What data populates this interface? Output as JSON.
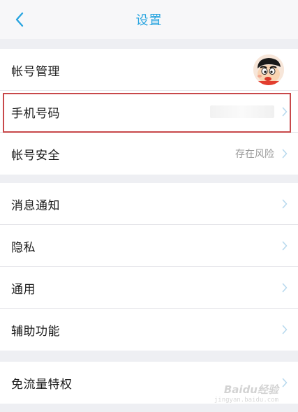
{
  "header": {
    "title": "设置"
  },
  "groups": {
    "account": {
      "account_management": {
        "label": "帐号管理"
      },
      "phone_number": {
        "label": "手机号码"
      },
      "account_security": {
        "label": "帐号安全",
        "value": "存在风险"
      }
    },
    "general": {
      "notifications": {
        "label": "消息通知"
      },
      "privacy": {
        "label": "隐私"
      },
      "general_settings": {
        "label": "通用"
      },
      "accessibility": {
        "label": "辅助功能"
      }
    },
    "data": {
      "free_traffic": {
        "label": "免流量特权"
      }
    }
  },
  "watermark": {
    "brand": "Baidu经验",
    "url": "jingyan.baidu.com"
  },
  "colors": {
    "accent": "#2aa5e0",
    "highlight_border": "#c8484a",
    "chevron": "#b8d9ee"
  },
  "icons": {
    "back": "chevron-left-icon",
    "row_arrow": "chevron-right-icon"
  }
}
